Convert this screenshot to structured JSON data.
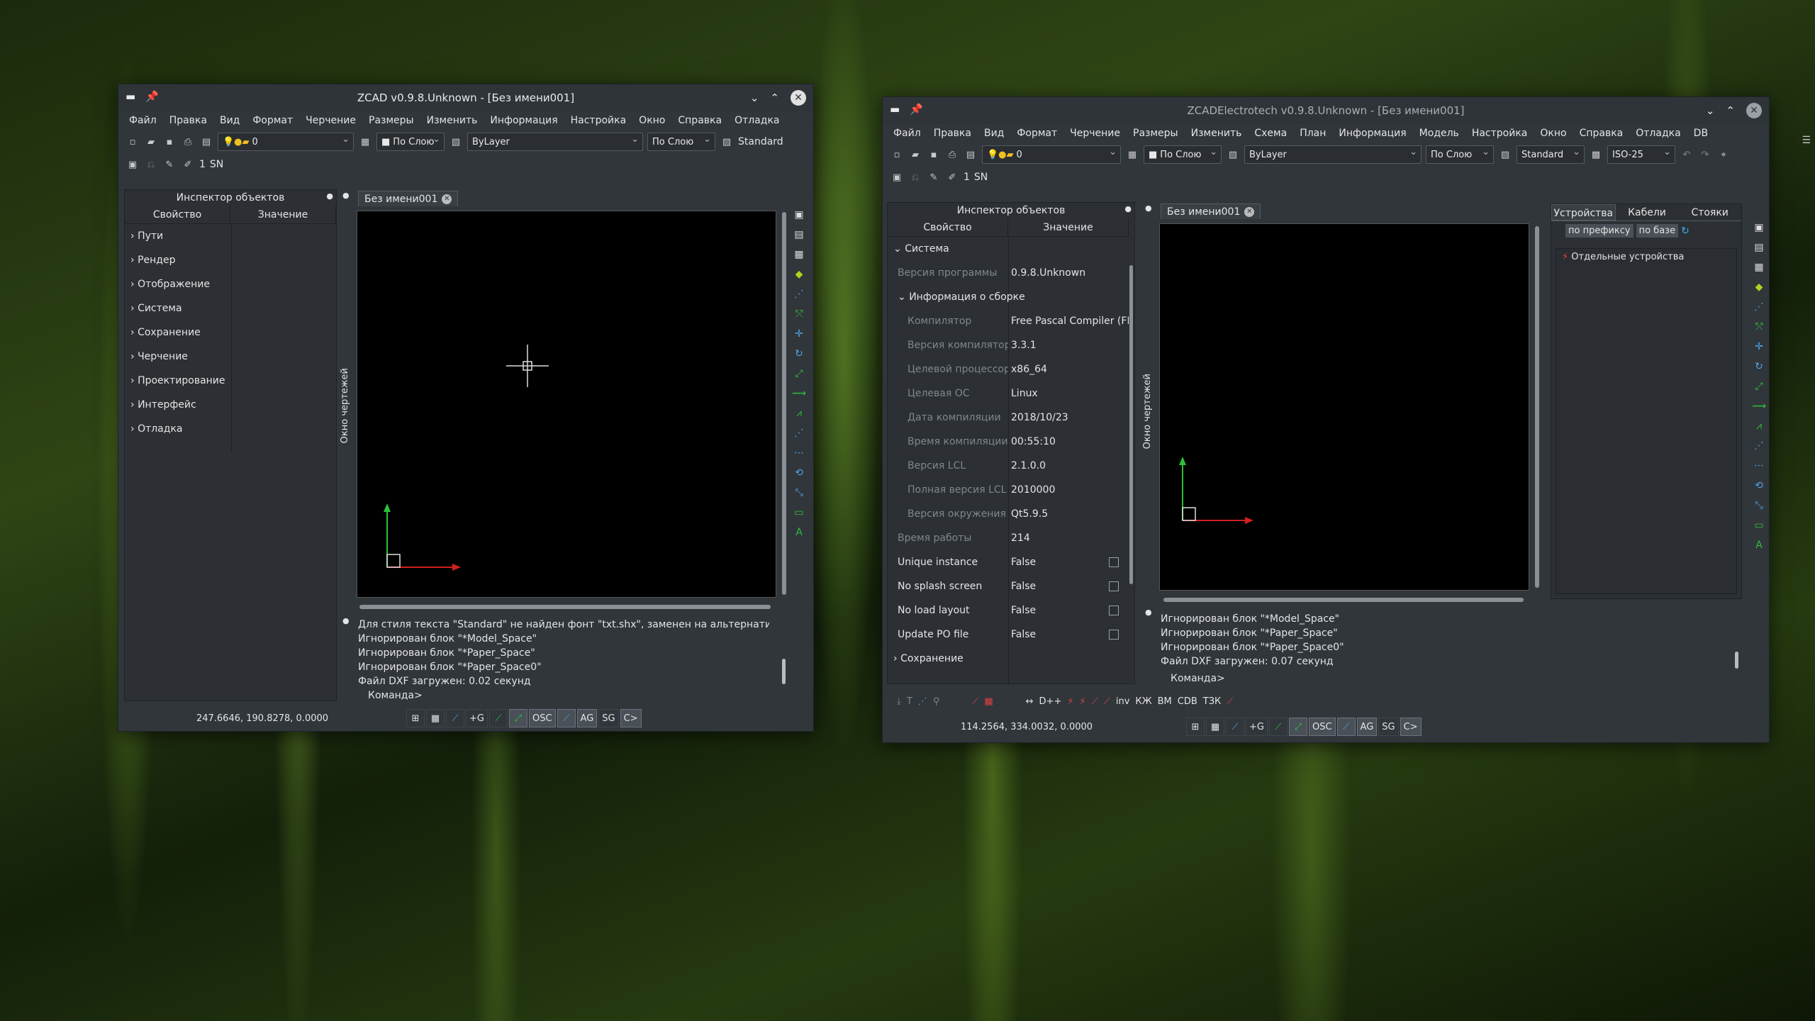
{
  "colors": {
    "window_bg": "#31363b",
    "canvas": "#000000",
    "axis_y": "#2fbf3a",
    "axis_x": "#d02020",
    "accent": "#3daee9"
  },
  "win1": {
    "title": "ZCAD v0.9.8.Unknown - [Без имени001]",
    "menu": [
      "Файл",
      "Правка",
      "Вид",
      "Формат",
      "Черчение",
      "Размеры",
      "Изменить",
      "Информация",
      "Настройка",
      "Окно",
      "Справка",
      "Отладка"
    ],
    "toolbar": {
      "layer": "0",
      "color": "По Слою",
      "linetype": "ByLayer",
      "lineweight": "По Слою",
      "textstyle": "Standard",
      "num": "1",
      "sn": "SN"
    },
    "inspector": {
      "title": "Инспектор объектов",
      "col1": "Свойство",
      "col2": "Значение",
      "items": [
        "Пути",
        "Рендер",
        "Отображение",
        "Система",
        "Сохранение",
        "Черчение",
        "Проектирование",
        "Интерфейс",
        "Отладка"
      ]
    },
    "tab": "Без имени001",
    "side_label": "Окно чертежей",
    "log": [
      "Для стиля текста \"Standard\" не найден фонт \"txt.shx\", заменен на альтернативный",
      "Игнорирован блок \"*Model_Space\"",
      "Игнорирован блок \"*Paper_Space\"",
      "Игнорирован блок \"*Paper_Space0\"",
      "Файл DXF загружен:  0.02 секунд"
    ],
    "command": "Команда>",
    "coords": "247.6646, 190.8278, 0.0000",
    "status": [
      "+G",
      "OSC",
      "AG",
      "SG",
      "C>"
    ]
  },
  "win2": {
    "title": "ZCADElectrotech v0.9.8.Unknown - [Без имени001]",
    "menu": [
      "Файл",
      "Правка",
      "Вид",
      "Формат",
      "Черчение",
      "Размеры",
      "Изменить",
      "Схема",
      "План",
      "Информация",
      "Модель",
      "Настройка",
      "Окно",
      "Справка",
      "Отладка",
      "DB"
    ],
    "toolbar": {
      "layer": "0",
      "color": "По Слою",
      "linetype": "ByLayer",
      "lineweight": "По Слою",
      "textstyle": "Standard",
      "dimstyle": "ISO-25",
      "num": "1",
      "sn": "SN"
    },
    "inspector": {
      "title": "Инспектор объектов",
      "col1": "Свойство",
      "col2": "Значение",
      "system": "Система",
      "rows": [
        {
          "p": "Версия программы",
          "v": "0.9.8.Unknown"
        },
        {
          "p": "Информация о сборке",
          "v": ""
        },
        {
          "p": "Компилятор",
          "v": "Free Pascal Compiler (FPC"
        },
        {
          "p": "Версия компилятора",
          "v": "3.3.1"
        },
        {
          "p": "Целевой процессор",
          "v": "x86_64"
        },
        {
          "p": "Целевая ОС",
          "v": "Linux"
        },
        {
          "p": "Дата компиляции",
          "v": "2018/10/23"
        },
        {
          "p": "Время компиляции",
          "v": "00:55:10"
        },
        {
          "p": "Версия LCL",
          "v": "2.1.0.0"
        },
        {
          "p": "Полная версия LCL",
          "v": "2010000"
        },
        {
          "p": "Версия окружения",
          "v": "Qt5.9.5"
        },
        {
          "p": "Время работы",
          "v": "214"
        },
        {
          "p": "Unique instance",
          "v": "False"
        },
        {
          "p": "No splash screen",
          "v": "False"
        },
        {
          "p": "No load layout",
          "v": "False"
        },
        {
          "p": "Update PO file",
          "v": "False"
        }
      ],
      "saving": "Сохранение"
    },
    "tab": "Без имени001",
    "side_label": "Окно чертежей",
    "right_tabs": [
      "Устройства",
      "Кабели",
      "Стояки"
    ],
    "filter_btns": [
      "по префиксу",
      "по базе"
    ],
    "tree_item": "Отдельные устройства",
    "log": [
      "Игнорирован блок \"*Model_Space\"",
      "Игнорирован блок \"*Paper_Space\"",
      "Игнорирован блок \"*Paper_Space0\"",
      "Файл DXF загружен:  0.07 секунд"
    ],
    "command": "Команда>",
    "extra_tb": [
      "↔",
      "D++",
      "inv",
      "КЖ",
      "ВМ",
      "CDB",
      "ТЗК"
    ],
    "coords": "114.2564, 334.0032, 0.0000",
    "status": [
      "+G",
      "OSC",
      "AG",
      "SG",
      "C>"
    ]
  }
}
